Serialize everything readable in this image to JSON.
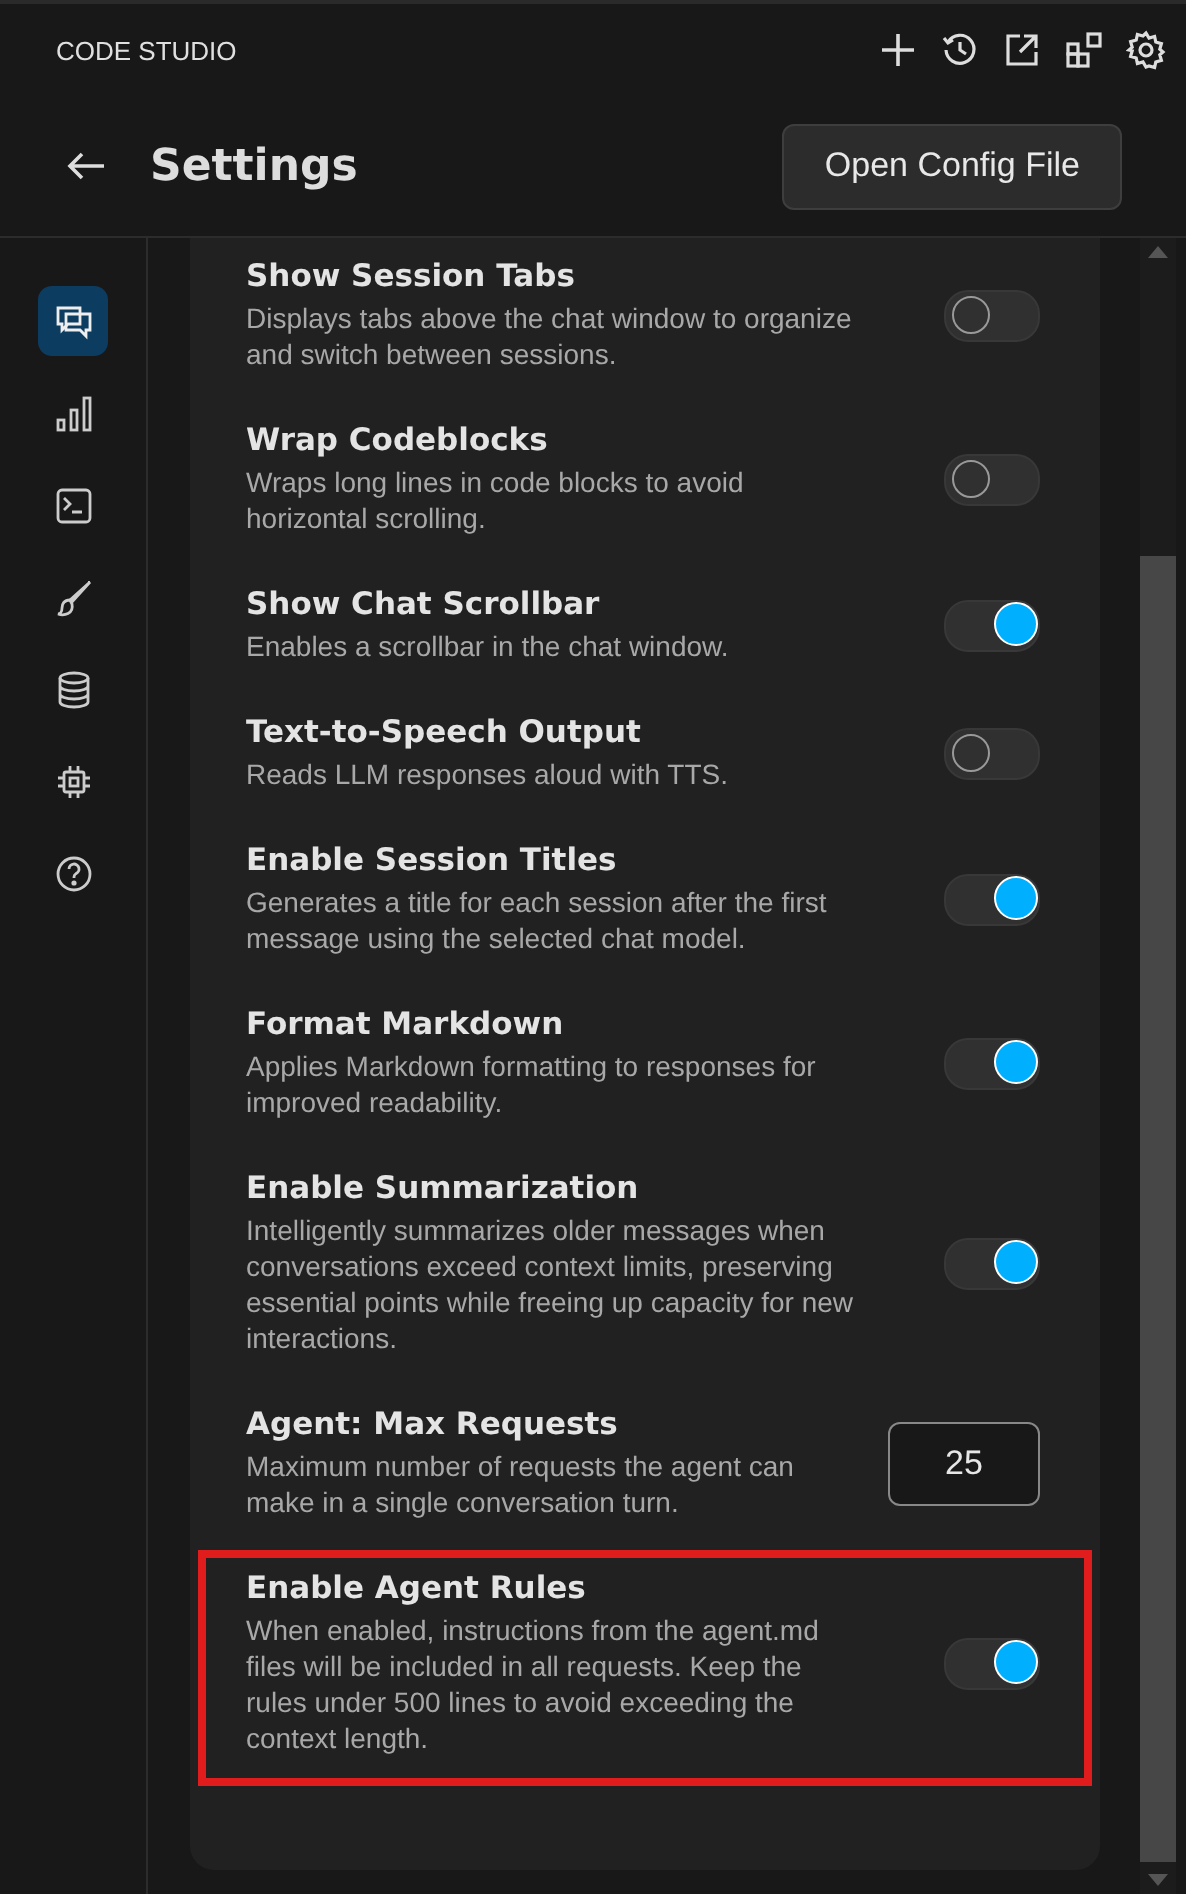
{
  "app_title": "CODE STUDIO",
  "header": {
    "title": "Settings",
    "button": "Open Config File"
  },
  "sidebar": {
    "items": [
      {
        "selected": true
      },
      {
        "selected": false
      },
      {
        "selected": false
      },
      {
        "selected": false
      },
      {
        "selected": false
      },
      {
        "selected": false
      },
      {
        "selected": false
      }
    ]
  },
  "settings": [
    {
      "kind": "toggle",
      "title": "Show Session Tabs",
      "description": "Displays tabs above the chat window to organize and switch between sessions.",
      "on": false,
      "highlighted": false
    },
    {
      "kind": "toggle",
      "title": "Wrap Codeblocks",
      "description": "Wraps long lines in code blocks to avoid horizontal scrolling.",
      "on": false,
      "highlighted": false
    },
    {
      "kind": "toggle",
      "title": "Show Chat Scrollbar",
      "description": "Enables a scrollbar in the chat window.",
      "on": true,
      "highlighted": false
    },
    {
      "kind": "toggle",
      "title": "Text-to-Speech Output",
      "description": "Reads LLM responses aloud with TTS.",
      "on": false,
      "highlighted": false
    },
    {
      "kind": "toggle",
      "title": "Enable Session Titles",
      "description": "Generates a title for each session after the first message using the selected chat model.",
      "on": true,
      "highlighted": false
    },
    {
      "kind": "toggle",
      "title": "Format Markdown",
      "description": "Applies Markdown formatting to responses for improved readability.",
      "on": true,
      "highlighted": false
    },
    {
      "kind": "toggle",
      "title": "Enable Summarization",
      "description": "Intelligently summarizes older messages when conversations exceed context limits, preserving essential points while freeing up capacity for new interactions.",
      "on": true,
      "highlighted": false
    },
    {
      "kind": "number",
      "title": "Agent: Max Requests",
      "description": "Maximum number of requests the agent can make in a single conversation turn.",
      "value": "25",
      "highlighted": false
    },
    {
      "kind": "toggle",
      "title": "Enable Agent Rules",
      "description": "When enabled, instructions from the agent.md files will be included in all requests. Keep the rules under 500 lines to avoid exceeding the context length.",
      "on": true,
      "highlighted": true
    }
  ]
}
